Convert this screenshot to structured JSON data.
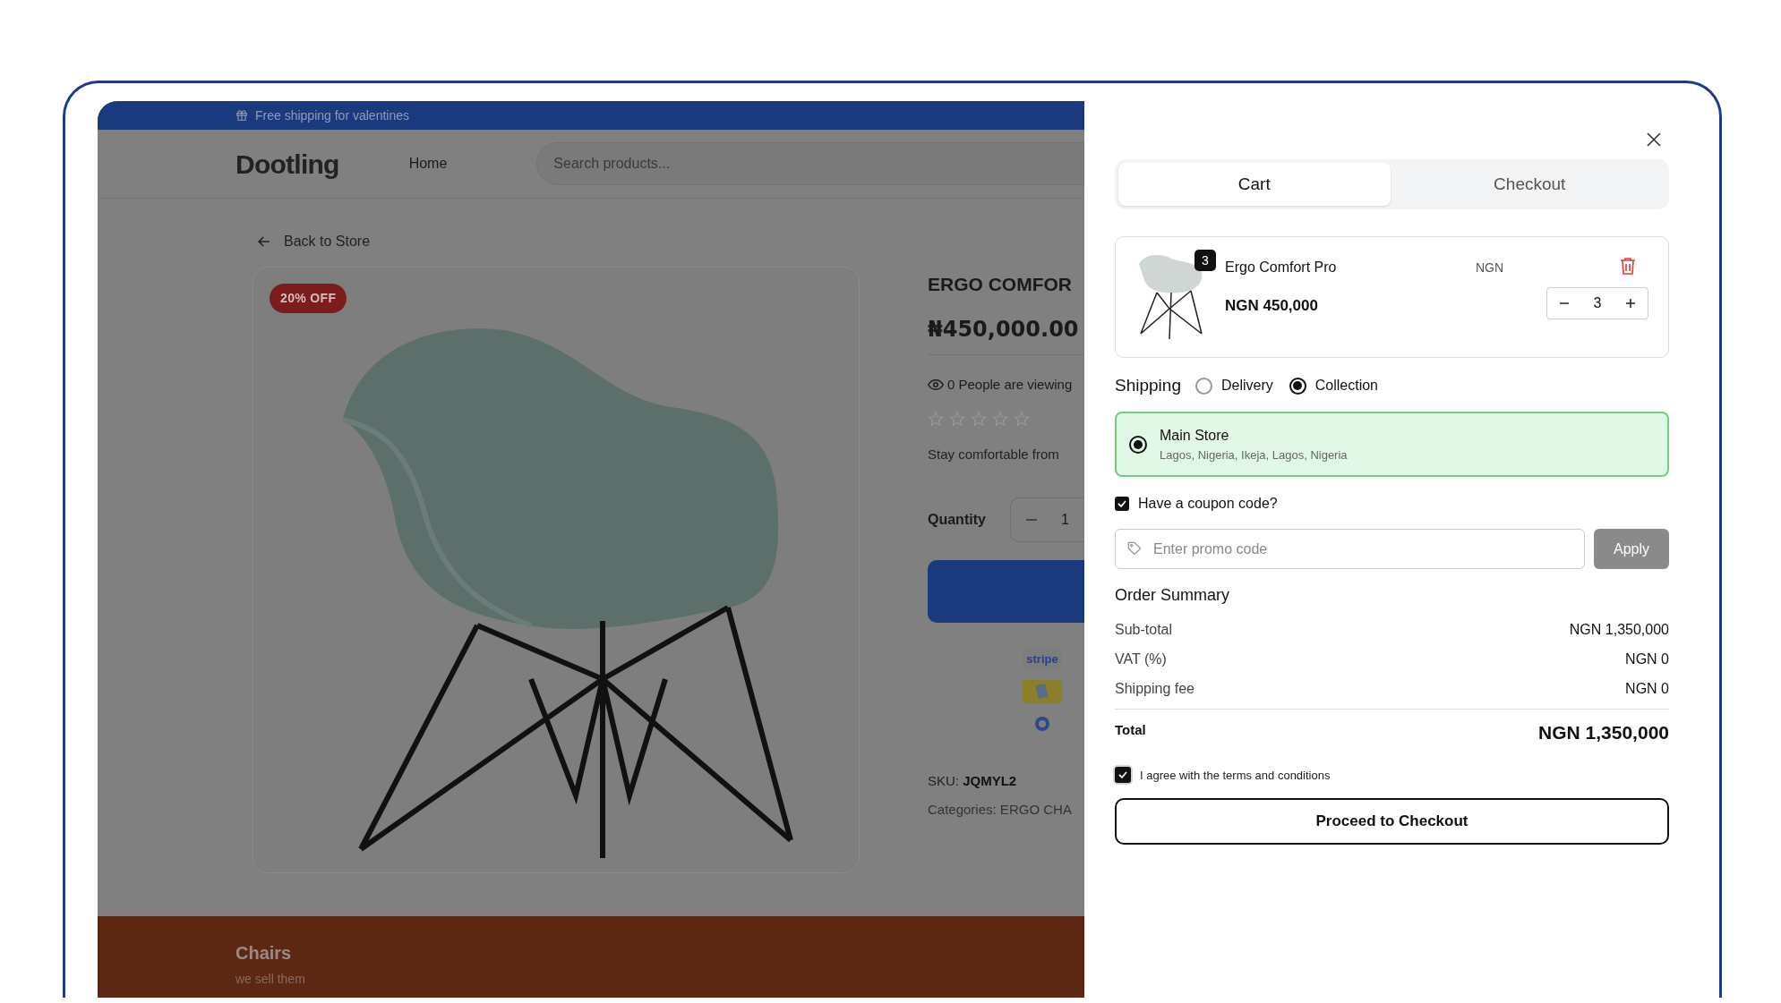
{
  "banner": {
    "text": "Free shipping for valentines"
  },
  "header": {
    "logo": "Dootling",
    "nav": [
      {
        "label": "Home"
      }
    ],
    "search": {
      "placeholder": "Search products..."
    }
  },
  "back_link": "Back to Store",
  "product": {
    "badge": "20% OFF",
    "title": "ERGO COMFOR",
    "price": "₦450,000.00",
    "viewers": "0 People are viewing",
    "stars": 0,
    "description": "Stay comfortable from",
    "quantity_label": "Quantity",
    "quantity": "1",
    "payment_methods": [
      {
        "kind": "stripe",
        "label": "stripe"
      },
      {
        "kind": "card"
      },
      {
        "kind": "diners"
      }
    ],
    "sku_label": "SKU:",
    "sku": "JQMYL2",
    "categories": "Categories: ERGO CHA"
  },
  "footer": {
    "title": "Chairs",
    "subtitle": "we sell them"
  },
  "cart_panel": {
    "tabs": [
      {
        "label": "Cart",
        "selected": true
      },
      {
        "label": "Checkout",
        "selected": false
      }
    ],
    "items": [
      {
        "name": "Ergo Comfort Pro",
        "currency": "NGN",
        "price": "NGN 450,000",
        "badge": "3",
        "quantity": "3"
      }
    ],
    "shipping": {
      "label": "Shipping",
      "options": [
        {
          "label": "Delivery",
          "selected": false
        },
        {
          "label": "Collection",
          "selected": true
        }
      ]
    },
    "stores": [
      {
        "name": "Main Store",
        "address": "Lagos, Nigeria, Ikeja, Lagos, Nigeria",
        "selected": true
      }
    ],
    "coupon": {
      "label": "Have a coupon code?",
      "checked": true,
      "placeholder": "Enter promo code",
      "apply": "Apply"
    },
    "summary": {
      "title": "Order Summary",
      "rows": [
        {
          "label": "Sub-total",
          "value": "NGN 1,350,000"
        },
        {
          "label": "VAT (%)",
          "value": "NGN 0"
        },
        {
          "label": "Shipping fee",
          "value": "NGN 0"
        }
      ],
      "total_label": "Total",
      "total_value": "NGN 1,350,000"
    },
    "terms": {
      "label": "I agree with the terms and conditions",
      "checked": true
    },
    "proceed": "Proceed to Checkout"
  }
}
